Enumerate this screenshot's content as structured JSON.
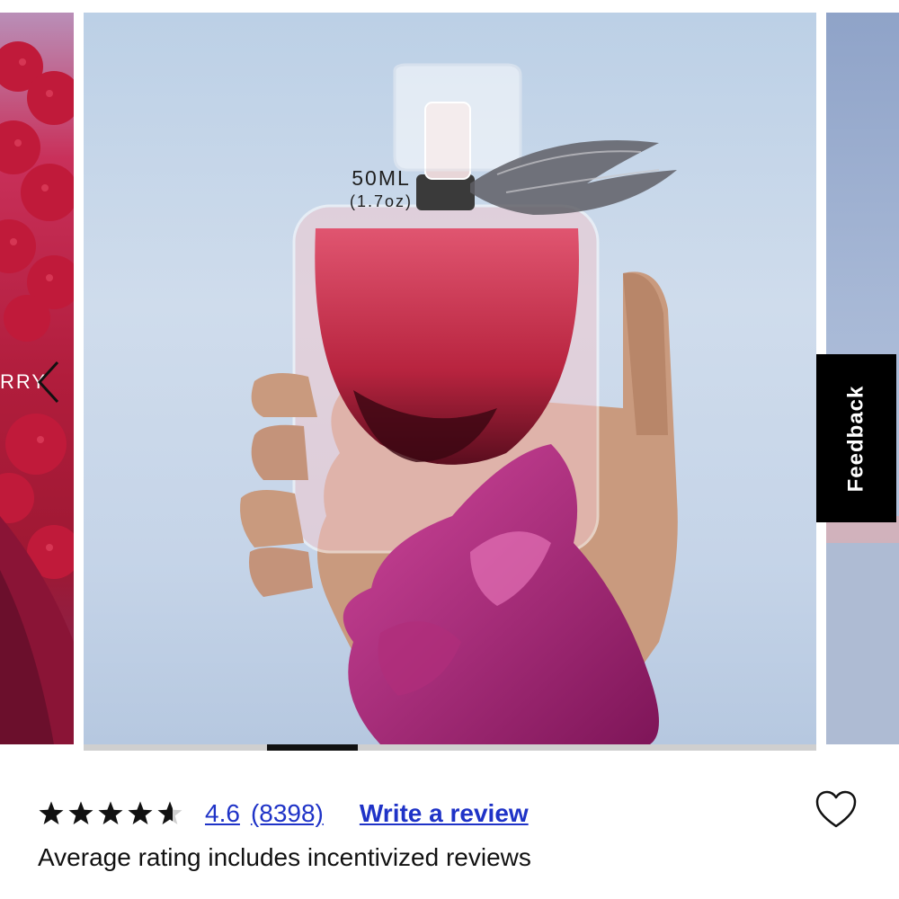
{
  "carousel": {
    "prev_slide_text": "RRY",
    "size_ml": "50ML",
    "size_oz": "(1.7oz)",
    "prev_icon": "chevron-left-icon",
    "current_slide": 3,
    "total_slides": 8
  },
  "feedback": {
    "label": "Feedback"
  },
  "rating": {
    "stars_value": 4.6,
    "value": "4.6",
    "count": "(8398)",
    "write_review": "Write a review",
    "note": "Average rating includes incentivized reviews",
    "star_icon": "star-icon",
    "link_color": "#1f33c7"
  },
  "favorite": {
    "icon": "heart-icon"
  }
}
